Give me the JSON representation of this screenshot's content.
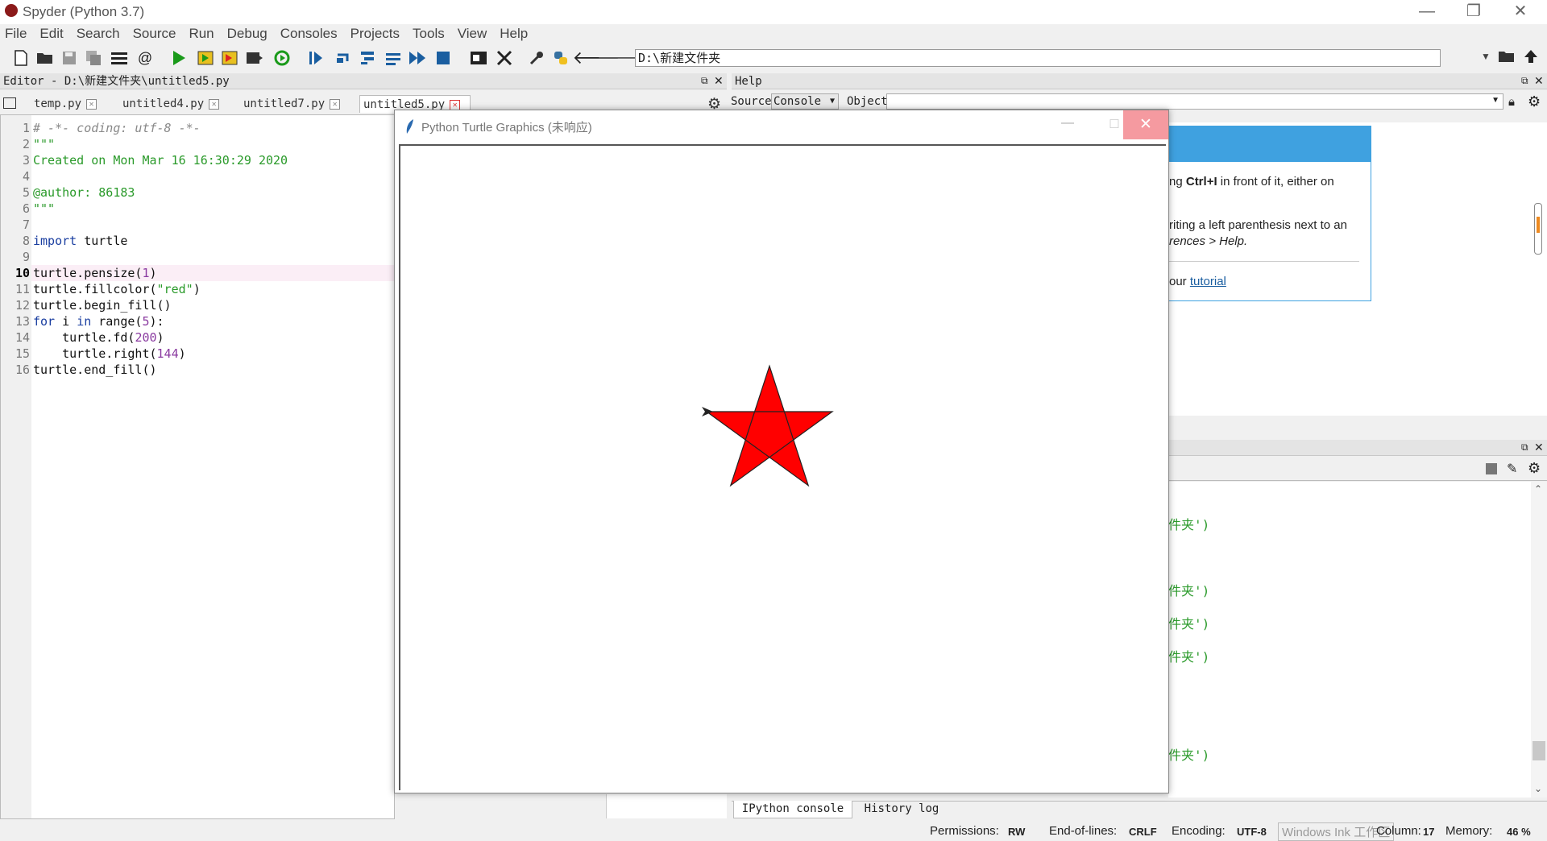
{
  "window": {
    "title": "Spyder (Python 3.7)"
  },
  "menu": [
    "File",
    "Edit",
    "Search",
    "Source",
    "Run",
    "Debug",
    "Consoles",
    "Projects",
    "Tools",
    "View",
    "Help"
  ],
  "toolbar": {
    "path": "D:\\新建文件夹"
  },
  "editor": {
    "header": "Editor - D:\\新建文件夹\\untitled5.py",
    "tabs": [
      {
        "label": "temp.py"
      },
      {
        "label": "untitled4.py"
      },
      {
        "label": "untitled7.py"
      },
      {
        "label": "untitled5.py"
      }
    ],
    "line_numbers": [
      "1",
      "2",
      "3",
      "4",
      "5",
      "6",
      "7",
      "8",
      "9",
      "10",
      "11",
      "12",
      "13",
      "14",
      "15",
      "16"
    ]
  },
  "help": {
    "header": "Help",
    "source_label": "Source",
    "source_value": "Console",
    "object_label": "Object",
    "line1_prefix": "ng ",
    "line1_bold": "Ctrl+I",
    "line1_suffix": " in front of it, either on",
    "line2": "riting a left parenthesis next to an",
    "line3": "rences > Help.",
    "line4_prefix": "our ",
    "line4_link": "tutorial"
  },
  "console": {
    "lines": [
      "件夹')",
      "件夹')",
      "件夹')",
      "件夹')",
      "件夹')"
    ],
    "tabs": [
      "IPython console",
      "History log"
    ]
  },
  "turtle": {
    "title": "Python Turtle Graphics (未响应)",
    "fill_color": "#ff0000",
    "star_points": 5,
    "side_length": 200,
    "turn_angle": 144
  },
  "status": {
    "permissions_label": "Permissions:",
    "permissions": "RW",
    "eol_label": "End-of-lines:",
    "eol": "CRLF",
    "encoding_label": "Encoding:",
    "encoding": "UTF-8",
    "watermark": "Windows Ink 工作区",
    "column_label": "Column:",
    "column": "17",
    "memory_label": "Memory:",
    "memory": "46 %"
  }
}
